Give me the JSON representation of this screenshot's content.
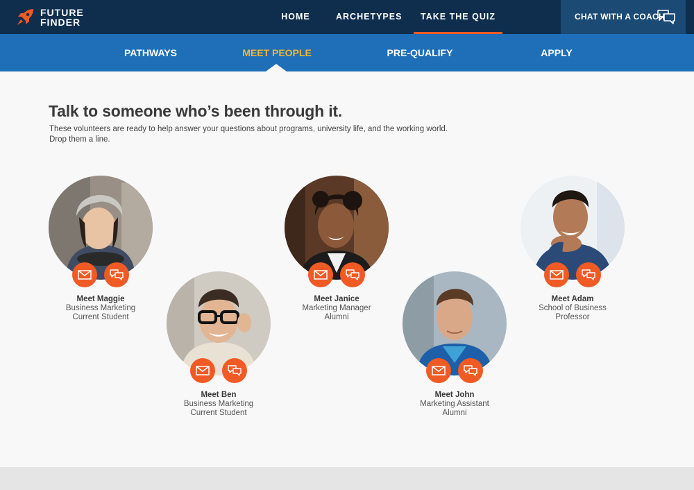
{
  "brand": {
    "line1": "FUTURE",
    "line2": "FINDER"
  },
  "topnav": [
    {
      "label": "HOME"
    },
    {
      "label": "ARCHETYPES"
    },
    {
      "label": "TAKE THE QUIZ"
    }
  ],
  "coach": {
    "label": "CHAT WITH A COACH"
  },
  "subnav": [
    {
      "label": "PATHWAYS"
    },
    {
      "label": "MEET PEOPLE"
    },
    {
      "label": "PRE-QUALIFY"
    },
    {
      "label": "APPLY"
    }
  ],
  "page": {
    "heading": "Talk to someone who’s been through it.",
    "subtext_line1": "These volunteers are ready to help answer your questions about programs, university life, and the working world.",
    "subtext_line2": "Drop them a line."
  },
  "people": [
    {
      "name": "Meet Maggie",
      "role": "Business Marketing",
      "status": "Current Student"
    },
    {
      "name": "Meet Ben",
      "role": "Business Marketing",
      "status": "Current Student"
    },
    {
      "name": "Meet Janice",
      "role": "Marketing Manager",
      "status": "Alumni"
    },
    {
      "name": "Meet John",
      "role": "Marketing Assistant",
      "status": "Alumni"
    },
    {
      "name": "Meet Adam",
      "role": "School of Business",
      "status": "Professor"
    }
  ],
  "colors": {
    "topbar": "#0f2e4e",
    "subnav": "#1e6fb7",
    "accent": "#f05a24",
    "active": "#f5b335"
  },
  "icons": {
    "logo": "rocket-icon",
    "coach": "chat-bubbles-icon",
    "mail": "envelope-icon",
    "chat": "chat-bubbles-icon"
  }
}
